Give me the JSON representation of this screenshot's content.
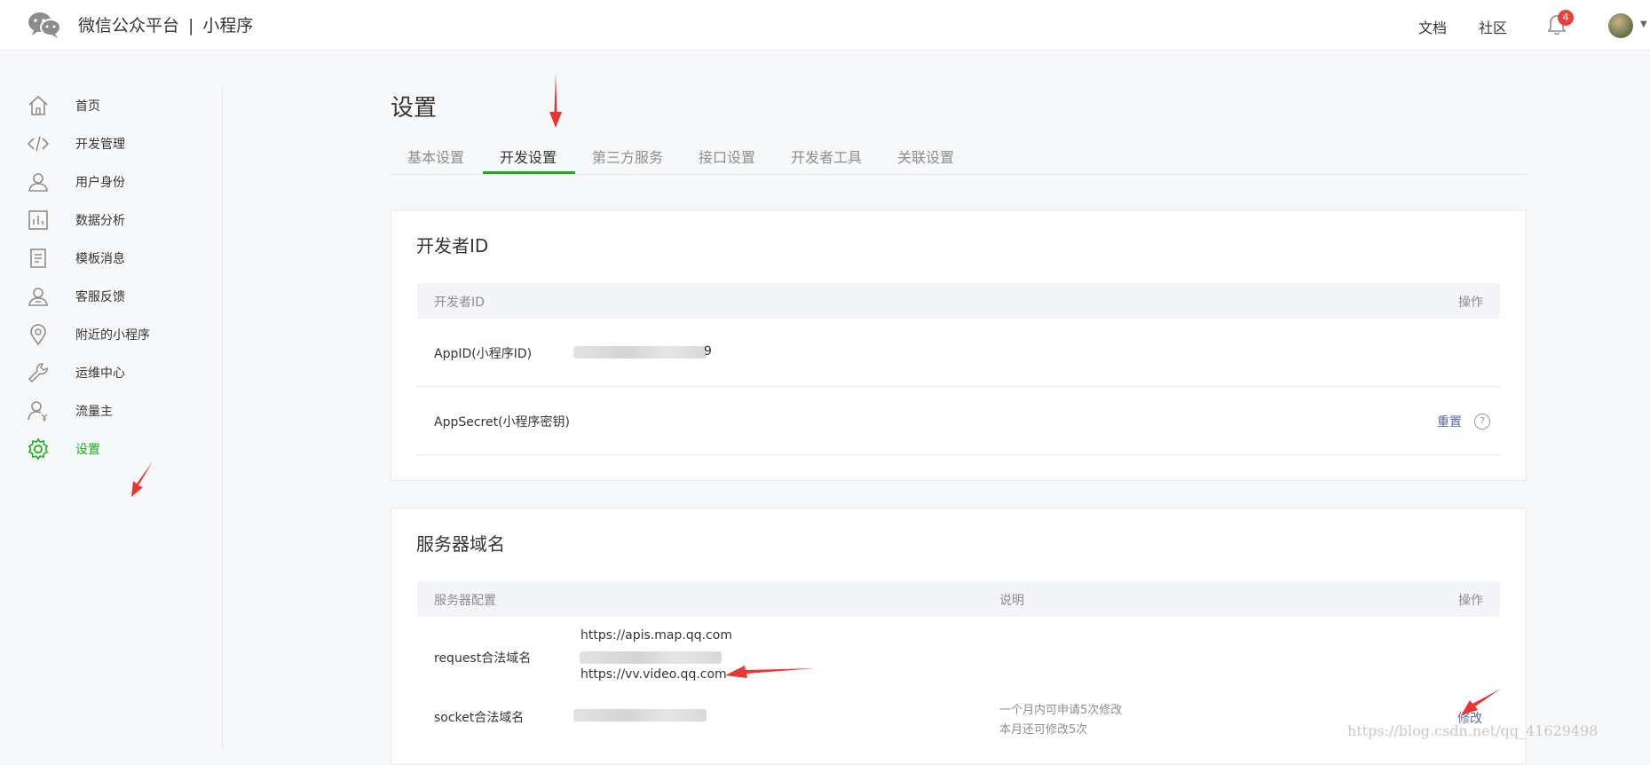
{
  "header": {
    "brand": "微信公众平台",
    "separator": "|",
    "product": "小程序",
    "links": [
      "文档",
      "社区"
    ],
    "notification_count": "4"
  },
  "sidebar": {
    "items": [
      {
        "label": "首页",
        "icon": "home-icon"
      },
      {
        "label": "开发管理",
        "icon": "code-icon"
      },
      {
        "label": "用户身份",
        "icon": "user-icon"
      },
      {
        "label": "数据分析",
        "icon": "chart-icon"
      },
      {
        "label": "模板消息",
        "icon": "document-icon"
      },
      {
        "label": "客服反馈",
        "icon": "support-icon"
      },
      {
        "label": "附近的小程序",
        "icon": "location-icon"
      },
      {
        "label": "运维中心",
        "icon": "wrench-icon"
      },
      {
        "label": "流量主",
        "icon": "user-yen-icon"
      },
      {
        "label": "设置",
        "icon": "gear-icon",
        "active": true
      }
    ],
    "active_color": "#1aad19"
  },
  "main": {
    "title": "设置",
    "tabs": [
      "基本设置",
      "开发设置",
      "第三方服务",
      "接口设置",
      "开发者工具",
      "关联设置"
    ],
    "active_tab": "开发设置"
  },
  "developer_id": {
    "title": "开发者ID",
    "columns": [
      "开发者ID",
      "操作"
    ],
    "rows": [
      {
        "label": "AppID(小程序ID)",
        "value_suffix": "9"
      },
      {
        "label": "AppSecret(小程序密钥)",
        "action": "重置",
        "help": "?"
      }
    ]
  },
  "server_domain": {
    "title": "服务器域名",
    "columns": [
      "服务器配置",
      "说明",
      "操作"
    ],
    "rows": [
      {
        "label": "request合法域名",
        "domains": [
          "https://apis.map.qq.com",
          "https://vv.video.qq.com"
        ]
      },
      {
        "label": "socket合法域名"
      }
    ],
    "notes": [
      "一个月内可申请5次修改",
      "本月还可修改5次"
    ],
    "action": "修改"
  },
  "watermark": "https://blog.csdn.net/qq_41629498",
  "colors": {
    "accent": "#1aad19",
    "link": "#576b95",
    "annotation_arrow": "#e93534"
  }
}
